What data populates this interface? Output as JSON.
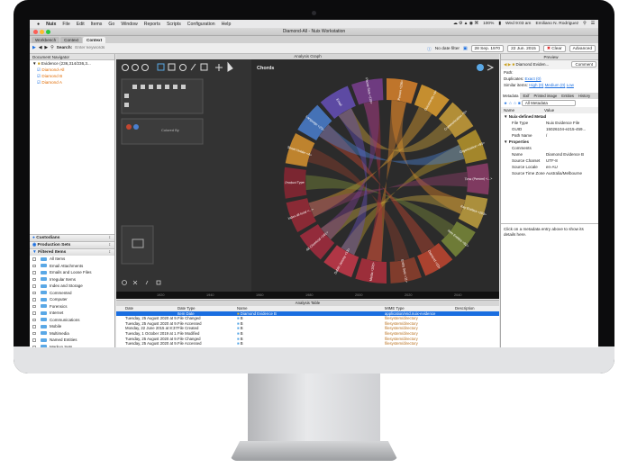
{
  "menubar": {
    "items": [
      "Nuix",
      "File",
      "Edit",
      "Items",
      "Go",
      "Window",
      "Reports",
      "Scripts",
      "Configuration",
      "Help"
    ],
    "battery": "100%",
    "clock": "Wed 9:03 am",
    "user": "Emiliano N. Rodriguez"
  },
  "window": {
    "title": "Diamond-All - Nuix Workstation"
  },
  "tabs": [
    "Workbench",
    "Context",
    "Context"
  ],
  "toolbar": {
    "search_label": "Search:",
    "search_placeholder": "Enter keywords",
    "date_filter": "No date filter",
    "date_from": "28 Sep. 1970",
    "date_to": "22 Jun. 2015",
    "clear": "Clear",
    "advanced": "Advanced"
  },
  "navigator": {
    "title": "Document Navigator",
    "rows": [
      "Evidence (236,314/236,3...",
      "Diamond-All",
      "Diamond B",
      "Diamond A"
    ]
  },
  "sections": {
    "custodians": "Custodians",
    "production_sets": "Production Sets",
    "filtered_items": "Filtered Items"
  },
  "filtered_items": [
    "All Items",
    "Email Attachments",
    "Emails and Loose Files",
    "Irregular Items",
    "Index and Storage",
    "Commented",
    "Computer",
    "Forensics",
    "Internet",
    "Communications",
    "Mobile",
    "Multimedia",
    "Named Entities",
    "Markup Sets",
    "Languages",
    "Writing Scripts"
  ],
  "graph": {
    "header": "Analysis Graph",
    "chart_title": "Chords",
    "colored_by": "Colored By",
    "axis_ticks": [
      "1920",
      "1940",
      "1960",
      "1980",
      "2000",
      "2020",
      "2040"
    ]
  },
  "chart_data": {
    "type": "chord",
    "title": "Chords",
    "nodes": [
      "Person <236>",
      "Documents <4>",
      "Communication <6>",
      "Organization <93>",
      "Time (Person) <...>",
      "Key Entities <203>",
      "Item Entities <92>",
      "Diamond <10>",
      "Entity Sets <11>",
      "Media <200>",
      "Dublin Jeremy <13>",
      "Alt Chemical <161>",
      "Index all local <...>",
      "Product Type",
      "Street Holder <4>",
      "Language <23>",
      "Email",
      "Phone Sets <118>"
    ],
    "node_colors": [
      "#d9822b",
      "#e0a030",
      "#caa03a",
      "#b9962c",
      "#8e3d6a",
      "#c2a13f",
      "#7a8a3a",
      "#c24630",
      "#8f3f2d",
      "#b02f3d",
      "#c8384a",
      "#a62b3e",
      "#9b2a37",
      "#8a2633",
      "#d8932f",
      "#4a7fcf",
      "#6650b8",
      "#7a3e8f"
    ]
  },
  "preview": {
    "title": "Preview",
    "item": "Diamond Eviden...",
    "comment": "Comment",
    "path_label": "Path:",
    "duplicates_label": "Duplicates:",
    "duplicates_value": "Exact (0)",
    "similar_label": "Similar items:",
    "similar_high": "High (0)",
    "similar_medium": "Medium (0)",
    "similar_low": "Low",
    "tabs": [
      "Metadata",
      "Exif",
      "Printed image",
      "Entities",
      "History"
    ],
    "all_metadata": "All Metadata",
    "col_name": "Name",
    "col_value": "Value",
    "group1": "Nuix-defined Metad",
    "meta": [
      {
        "name": "File Type",
        "value": "Nuix Evidence File"
      },
      {
        "name": "GUID",
        "value": "15026104-e215-459..."
      },
      {
        "name": "Path Name",
        "value": "/"
      }
    ],
    "group2": "Properties",
    "props": [
      {
        "name": "Comments",
        "value": ""
      },
      {
        "name": "Name",
        "value": "Diamond Evidence B"
      },
      {
        "name": "Source Charset",
        "value": "UTF-8"
      },
      {
        "name": "Source Locale",
        "value": "en-AU"
      },
      {
        "name": "Source Time Zone",
        "value": "Australia/Melbourne"
      }
    ],
    "hint": "Click on a metadata entry above to show its details here."
  },
  "table": {
    "title": "Analysis Table",
    "headers": [
      "Date",
      "Date Type",
      "Name",
      "MIME Type",
      "Description"
    ],
    "rows": [
      {
        "date": "",
        "type": "Item Date",
        "name": "Diamond Evidence B",
        "mime": "application/vnd.nuix-evidence"
      },
      {
        "date": "Tuesday, 25 August 2020 at 9...",
        "type": "File Changed",
        "name": "B",
        "mime": "filesystem/directory"
      },
      {
        "date": "Tuesday, 25 August 2020 at 9...",
        "type": "File Accessed",
        "name": "B",
        "mime": "filesystem/directory"
      },
      {
        "date": "Monday, 22 June 2015 at 8:37...",
        "type": "File Created",
        "name": "B",
        "mime": "filesystem/directory"
      },
      {
        "date": "Tuesday, 1 October 2019 at 1...",
        "type": "File Modified",
        "name": "B",
        "mime": "filesystem/directory"
      },
      {
        "date": "Tuesday, 25 August 2020 at 9...",
        "type": "File Changed",
        "name": "B",
        "mime": "filesystem/directory"
      },
      {
        "date": "Tuesday, 25 August 2020 at 9...",
        "type": "File Accessed",
        "name": "B",
        "mime": "filesystem/directory"
      }
    ]
  }
}
